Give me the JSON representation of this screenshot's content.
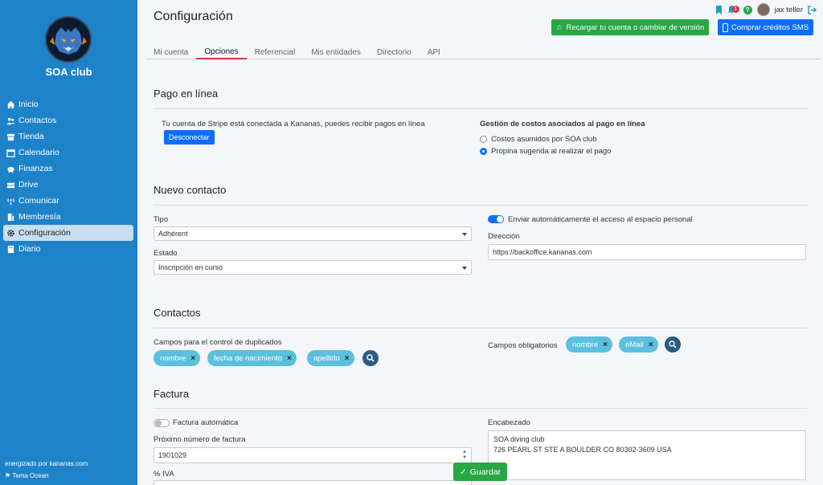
{
  "sidebar": {
    "club_name": "SOA club",
    "items": [
      {
        "label": "Inicio",
        "icon": "home-icon"
      },
      {
        "label": "Contactos",
        "icon": "users-icon"
      },
      {
        "label": "Tienda",
        "icon": "store-icon"
      },
      {
        "label": "Calendario",
        "icon": "calendar-icon"
      },
      {
        "label": "Finanzas",
        "icon": "piggy-bank-icon"
      },
      {
        "label": "Drive",
        "icon": "drive-icon"
      },
      {
        "label": "Comunicar",
        "icon": "broadcast-icon"
      },
      {
        "label": "Membresía",
        "icon": "membership-icon"
      },
      {
        "label": "Configuración",
        "icon": "gear-icon"
      },
      {
        "label": "Diario",
        "icon": "journal-icon"
      }
    ],
    "active_index": 8,
    "powered_by": "energizado por kananas.com",
    "theme": "Tema Ocean"
  },
  "header": {
    "title": "Configuración",
    "notification_count": "1",
    "user_name": "jax teller",
    "recharge_label": "Recargar tu cuenta o cambiar de versión",
    "sms_label": "Comprar créditos SMS"
  },
  "tabs": [
    "Mi cuenta",
    "Opciones",
    "Referencial",
    "Mis entidades",
    "Directorio",
    "API"
  ],
  "online_payment": {
    "title": "Pago en línea",
    "stripe_text": "Tu cuenta de Stripe está conectada a Kananas, puedes recibir pagos en línea",
    "disconnect_label": "Desconectar",
    "costs_title": "Gestión de costos asociados al pago en línea",
    "option1": "Costos asumidos por SOA club",
    "option2": "Propina sugerida al realizar el pago"
  },
  "new_contact": {
    "title": "Nuevo contacto",
    "tipo_label": "Tipo",
    "tipo_value": "Adhérent",
    "estado_label": "Estado",
    "estado_value": "Inscripción en curso",
    "auto_access_label": "Enviar automáticamente el acceso al espacio personal",
    "direccion_label": "Dirección",
    "direccion_value": "https://backoffice.kananas.com"
  },
  "contacts": {
    "title": "Contactos",
    "dup_label": "Campos para el control de duplicados",
    "dup_chips": [
      "nombre",
      "fecha de nacimiento",
      "apellido"
    ],
    "required_label": "Campos obligatorios",
    "required_chips": [
      "nombre",
      "eMail"
    ]
  },
  "invoice": {
    "title": "Factura",
    "auto_label": "Factura automática",
    "next_number_label": "Próximo número de factura",
    "next_number_value": "1901029",
    "vat_label": "% IVA",
    "header_label": "Encabezado",
    "header_value": "SOA diving club\n726 PEARL ST STE A BOULDER CO 80302-3609 USA"
  },
  "save_label": "Guardar"
}
